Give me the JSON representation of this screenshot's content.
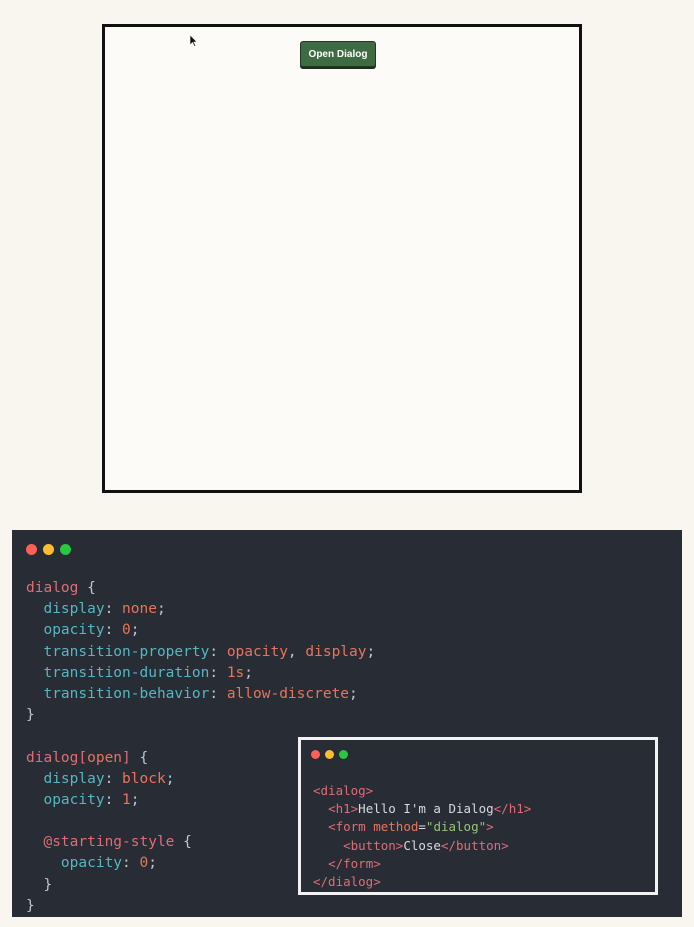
{
  "demo": {
    "open_button_label": "Open Dialog"
  },
  "icons": {
    "cursor": "arrow-cursor-icon",
    "window_controls": [
      "close-dot",
      "minimize-dot",
      "maximize-dot"
    ]
  },
  "colors": {
    "page_bg": "#f9f5ef",
    "button_bg": "#3f6b42",
    "code_bg": "#282c34",
    "dot_red": "#ff5f57",
    "dot_yellow": "#febc2e",
    "dot_green": "#28c840"
  },
  "css_code": {
    "b1_selector": "dialog",
    "b1_open": " {",
    "b1_display_prop": "display",
    "b1_display_val": "none",
    "b1_opacity_prop": "opacity",
    "b1_opacity_val": "0",
    "b1_tprop_prop": "transition-property",
    "b1_tprop_val1": "opacity",
    "b1_tprop_val2": "display",
    "b1_tdur_prop": "transition-duration",
    "b1_tdur_val": "1s",
    "b1_tbeh_prop": "transition-behavior",
    "b1_tbeh_val": "allow-discrete",
    "b1_close": "}",
    "b2_selector_a": "dialog[",
    "b2_selector_attr": "open",
    "b2_selector_b": "]",
    "b2_open": " {",
    "b2_display_prop": "display",
    "b2_display_val": "block",
    "b2_opacity_prop": "opacity",
    "b2_opacity_val": "1",
    "b3_at_rule": "@starting-style",
    "b3_open": " {",
    "b3_opacity_prop": "opacity",
    "b3_opacity_val": "0",
    "b3_close": "}",
    "b2_close": "}"
  },
  "html_code": {
    "l1_tag": "<dialog>",
    "l2_open_tag": "<h1>",
    "l2_text": "Hello I'm a Dialog",
    "l2_close_tag": "</h1>",
    "l3_tag": "<form",
    "l3_attr": "method",
    "l3_eq": "=",
    "l3_value": "\"dialog\"",
    "l3_end": ">",
    "l4_open_tag": "<button>",
    "l4_text": "Close",
    "l4_close_tag": "</button>",
    "l5_tag": "</form>",
    "l6_tag": "</dialog>"
  }
}
